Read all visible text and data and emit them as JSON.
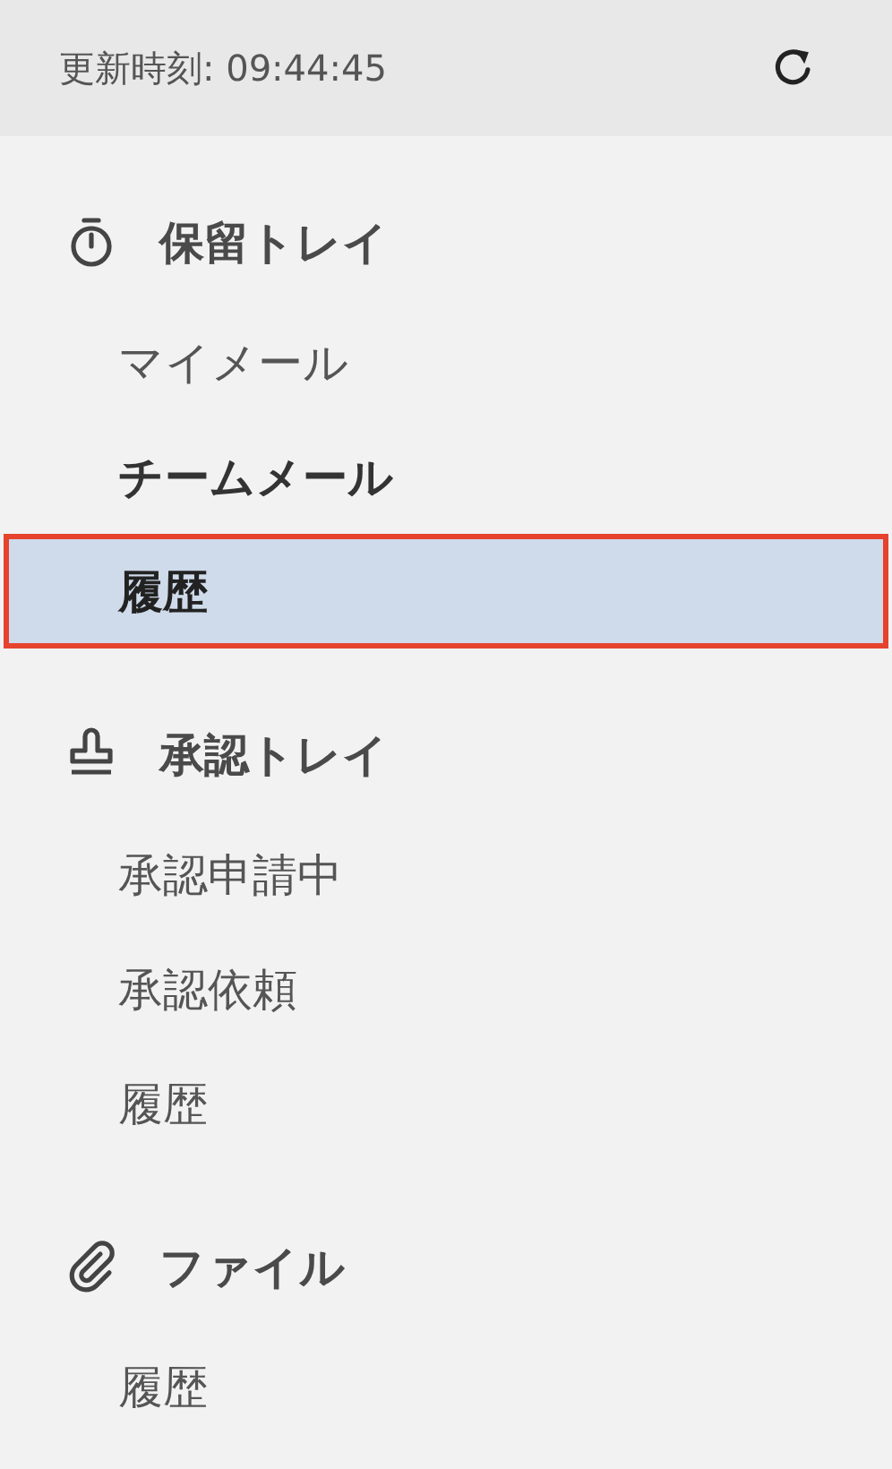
{
  "header": {
    "updated_label": "更新時刻: 09:44:45"
  },
  "sections": [
    {
      "kind": "hold",
      "title": "保留トレイ",
      "items": [
        {
          "label": "マイメール",
          "selected": false,
          "unread": false
        },
        {
          "label": "チームメール",
          "selected": false,
          "unread": true
        },
        {
          "label": "履歴",
          "selected": true,
          "unread": false
        }
      ]
    },
    {
      "kind": "approval",
      "title": "承認トレイ",
      "items": [
        {
          "label": "承認申請中",
          "selected": false,
          "unread": false
        },
        {
          "label": "承認依頼",
          "selected": false,
          "unread": false
        },
        {
          "label": "履歴",
          "selected": false,
          "unread": false
        }
      ]
    },
    {
      "kind": "file",
      "title": "ファイル",
      "items": [
        {
          "label": "履歴",
          "selected": false,
          "unread": false
        }
      ]
    }
  ]
}
